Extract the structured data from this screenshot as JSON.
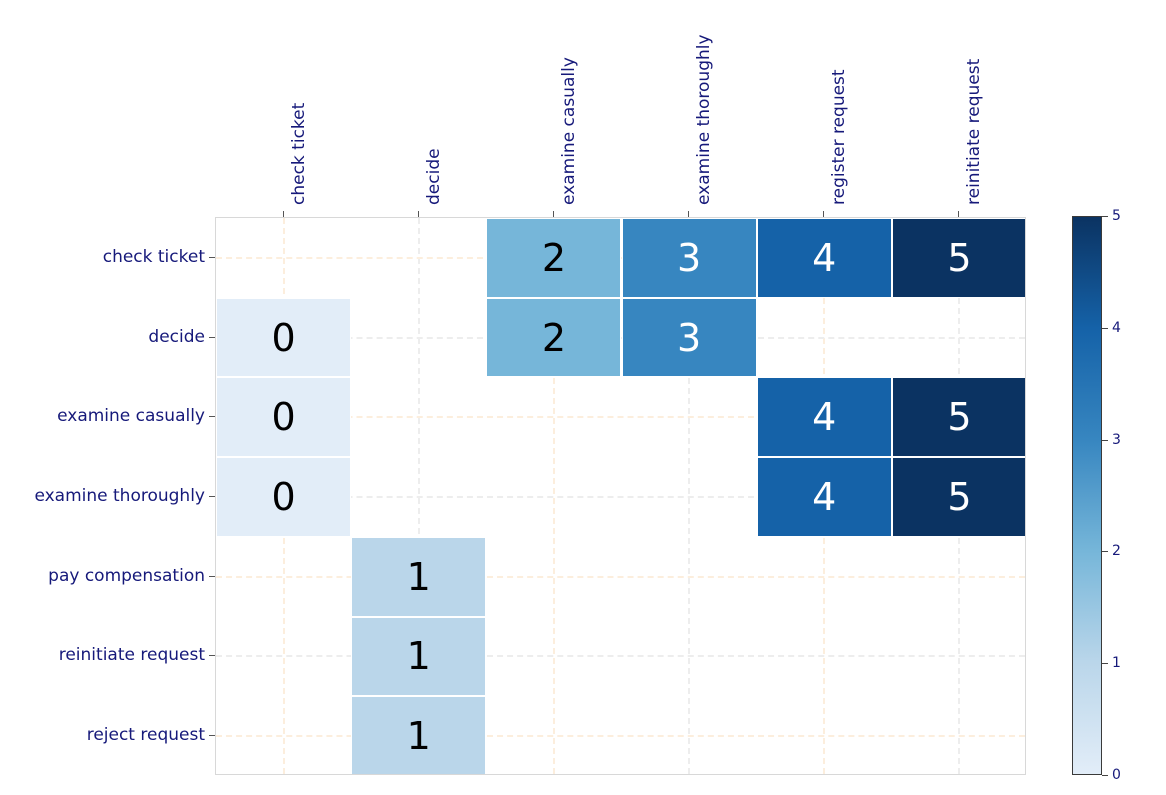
{
  "chart_data": {
    "type": "heatmap",
    "title": "",
    "xlabel": "",
    "ylabel": "",
    "grid": true,
    "legend_position": "right-colorbar",
    "columns": [
      "check ticket",
      "decide",
      "examine casually",
      "examine thoroughly",
      "register request",
      "reinitiate request"
    ],
    "rows": [
      "check ticket",
      "decide",
      "examine casually",
      "examine thoroughly",
      "pay compensation",
      "reinitiate request",
      "reject request"
    ],
    "values": [
      [
        null,
        null,
        2,
        3,
        4,
        5
      ],
      [
        0,
        null,
        2,
        3,
        null,
        null
      ],
      [
        0,
        null,
        null,
        null,
        4,
        5
      ],
      [
        0,
        null,
        null,
        null,
        4,
        5
      ],
      [
        null,
        1,
        null,
        null,
        null,
        null
      ],
      [
        null,
        1,
        null,
        null,
        null,
        null
      ],
      [
        null,
        1,
        null,
        null,
        null,
        null
      ]
    ],
    "colorbar": {
      "min": 0,
      "max": 5,
      "ticks": [
        "0",
        "1",
        "2",
        "3",
        "4",
        "5"
      ],
      "tick_values": [
        0,
        1,
        2,
        3,
        4,
        5
      ],
      "colormap": "Blues"
    },
    "value_colors": {
      "0": "#e2edf8",
      "1": "#bad6ea",
      "2": "#76b6d9",
      "3": "#3786c0",
      "4": "#1562a8",
      "5": "#0b3362"
    },
    "value_text_colors": {
      "0": "#000000",
      "1": "#000000",
      "2": "#000000",
      "3": "#ffffff",
      "4": "#ffffff",
      "5": "#ffffff"
    },
    "cell_labels": {
      "r0c2": "2",
      "r0c3": "3",
      "r0c4": "4",
      "r0c5": "5",
      "r1c0": "0",
      "r1c2": "2",
      "r1c3": "3",
      "r2c0": "0",
      "r2c4": "4",
      "r2c5": "5",
      "r3c0": "0",
      "r3c4": "4",
      "r3c5": "5",
      "r4c1": "1",
      "r5c1": "1",
      "r6c1": "1"
    },
    "colors": {
      "tick_label": "#16197a",
      "axes_edge": "#d8d8d8",
      "grid_peach": "#fceedd",
      "grid_gray": "#ededed",
      "cell_border": "#ffffff",
      "background": "#ffffff"
    }
  }
}
